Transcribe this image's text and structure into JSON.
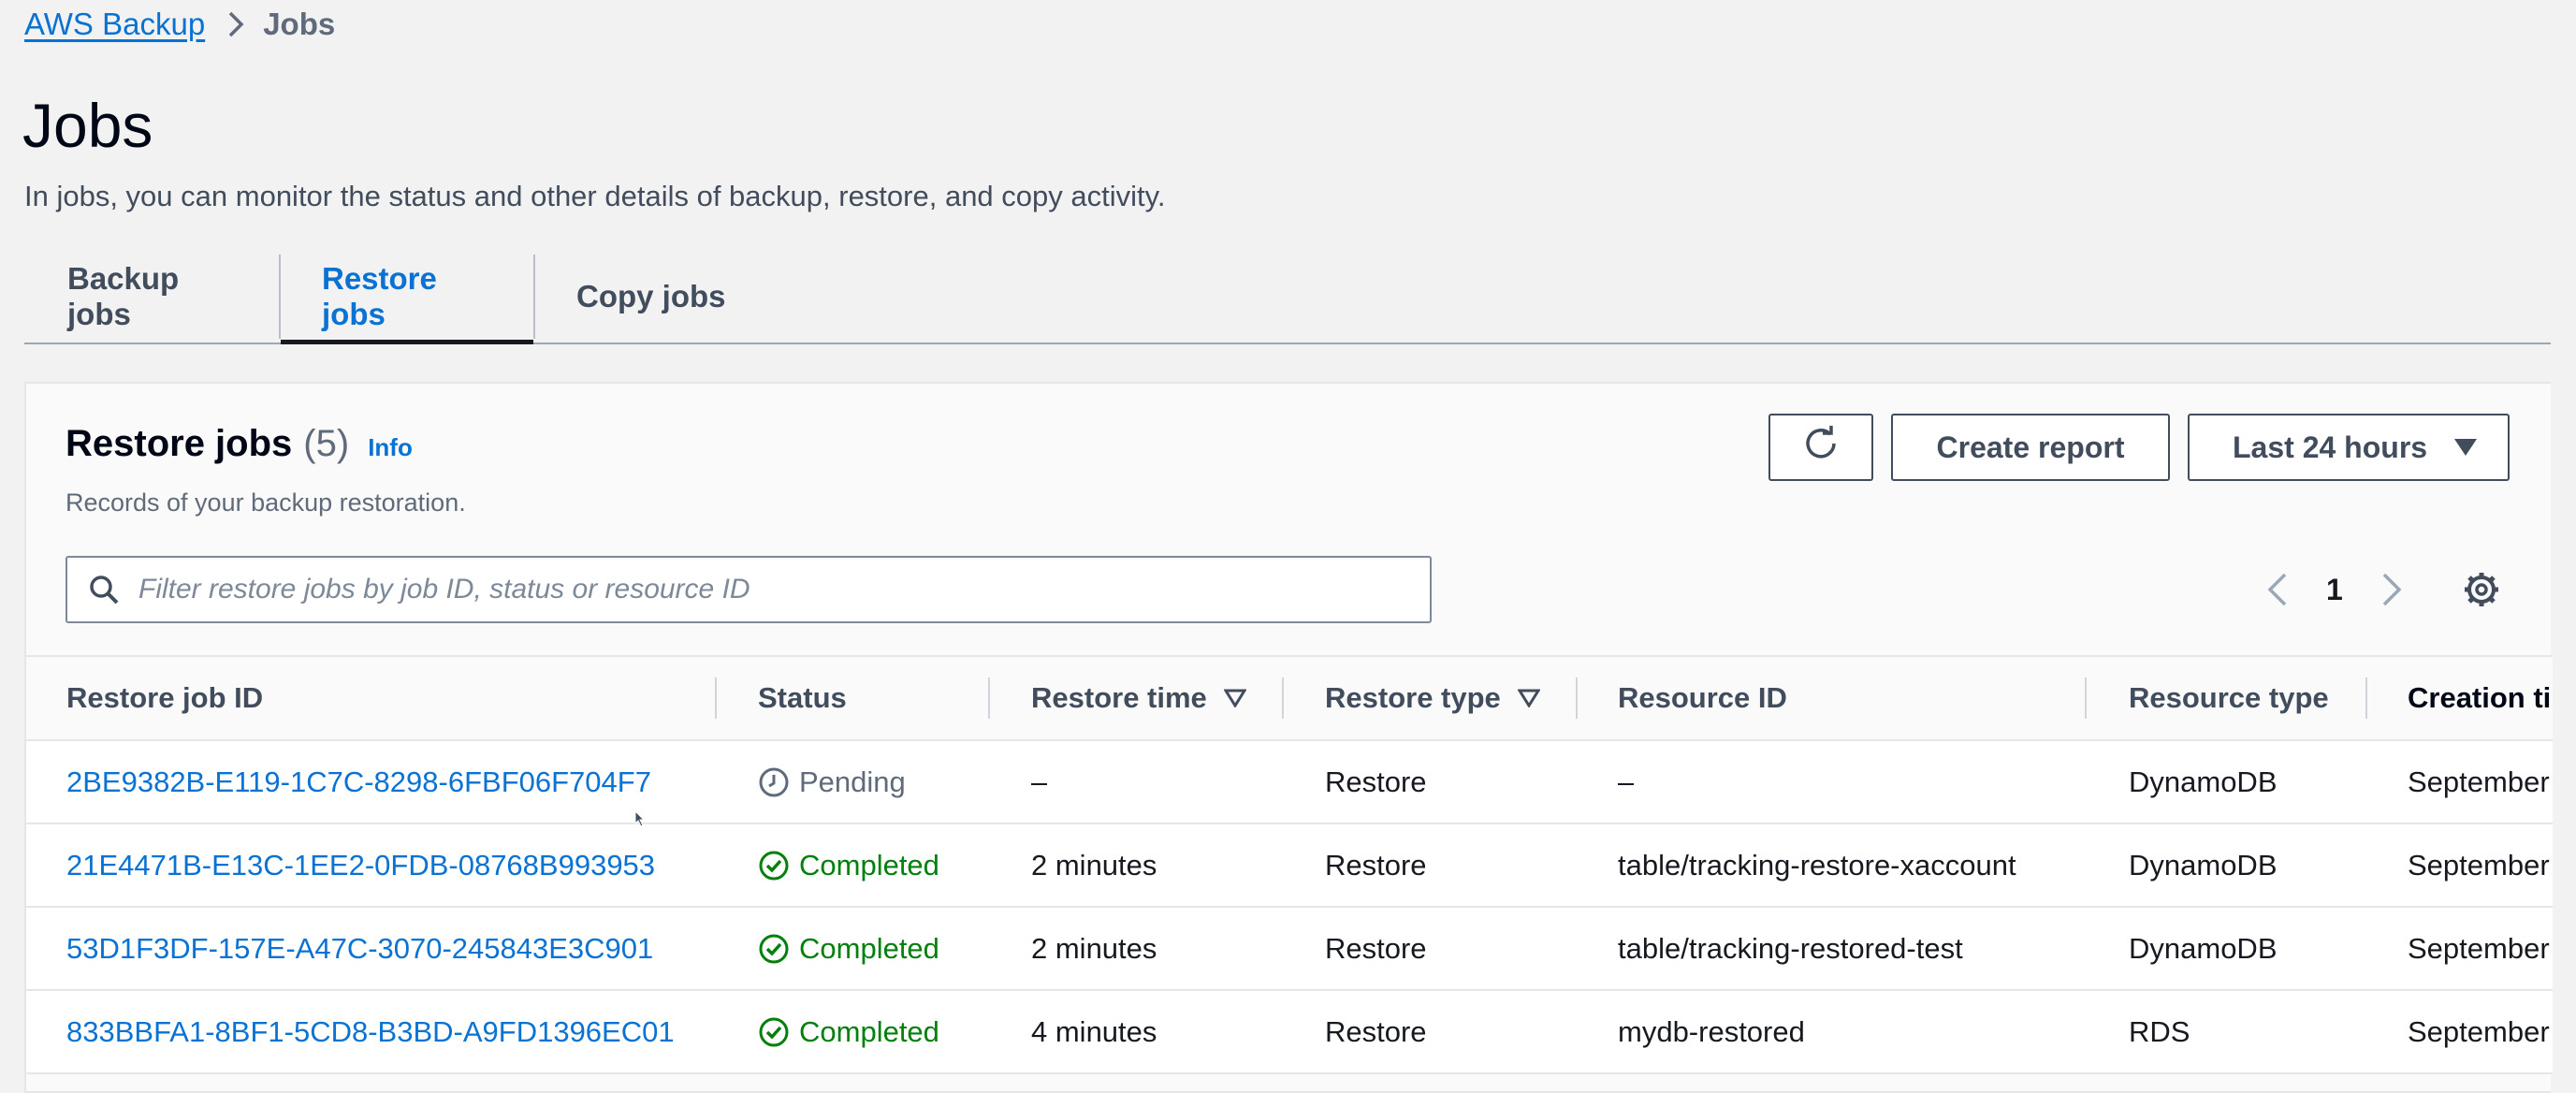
{
  "breadcrumb": {
    "parent": "AWS Backup",
    "current": "Jobs"
  },
  "page": {
    "title": "Jobs",
    "description": "In jobs, you can monitor the status and other details of backup, restore, and copy activity."
  },
  "tabs": [
    {
      "label": "Backup jobs",
      "active": false
    },
    {
      "label": "Restore jobs",
      "active": true
    },
    {
      "label": "Copy jobs",
      "active": false
    }
  ],
  "container": {
    "title": "Restore jobs",
    "count": "(5)",
    "info": "Info",
    "subtitle": "Records of your backup restoration.",
    "create_report": "Create report",
    "time_range": "Last 24 hours",
    "search_placeholder": "Filter restore jobs by job ID, status or resource ID",
    "page": "1"
  },
  "table": {
    "columns": [
      "Restore job ID",
      "Status",
      "Restore time",
      "Restore type",
      "Resource ID",
      "Resource type",
      "Creation ti"
    ],
    "rows": [
      {
        "job_id": "2BE9382B-E119-1C7C-8298-6FBF06F704F7",
        "status": "Pending",
        "restore_time": "–",
        "restore_type": "Restore",
        "resource_id": "–",
        "resource_type": "DynamoDB",
        "creation": "September"
      },
      {
        "job_id": "21E4471B-E13C-1EE2-0FDB-08768B993953",
        "status": "Completed",
        "restore_time": "2 minutes",
        "restore_type": "Restore",
        "resource_id": "table/tracking-restore-xaccount",
        "resource_type": "DynamoDB",
        "creation": "September"
      },
      {
        "job_id": "53D1F3DF-157E-A47C-3070-245843E3C901",
        "status": "Completed",
        "restore_time": "2 minutes",
        "restore_type": "Restore",
        "resource_id": "table/tracking-restored-test",
        "resource_type": "DynamoDB",
        "creation": "September"
      },
      {
        "job_id": "833BBFA1-8BF1-5CD8-B3BD-A9FD1396EC01",
        "status": "Completed",
        "restore_time": "4 minutes",
        "restore_type": "Restore",
        "resource_id": "mydb-restored",
        "resource_type": "RDS",
        "creation": "September"
      }
    ]
  },
  "colors": {
    "link": "#0972d3",
    "success": "#037f0c",
    "pending": "#5f6b7a",
    "text": "#16191f"
  }
}
